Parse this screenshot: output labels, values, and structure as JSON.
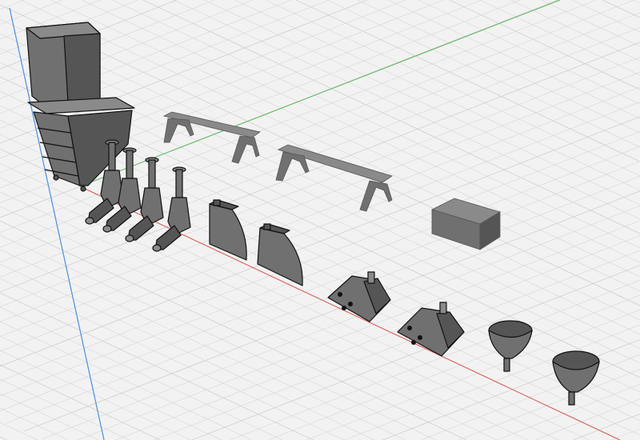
{
  "viewport": {
    "background": "#f2f2f2",
    "grid_color": "#d6d6d6",
    "grid_major_color": "#c4c4c4",
    "object_fill": "#707070",
    "object_light": "#8a8a8a",
    "object_dark": "#555555",
    "axes": {
      "x": "#d9534f",
      "y": "#5cb85c",
      "z": "#4a8fe0"
    }
  }
}
